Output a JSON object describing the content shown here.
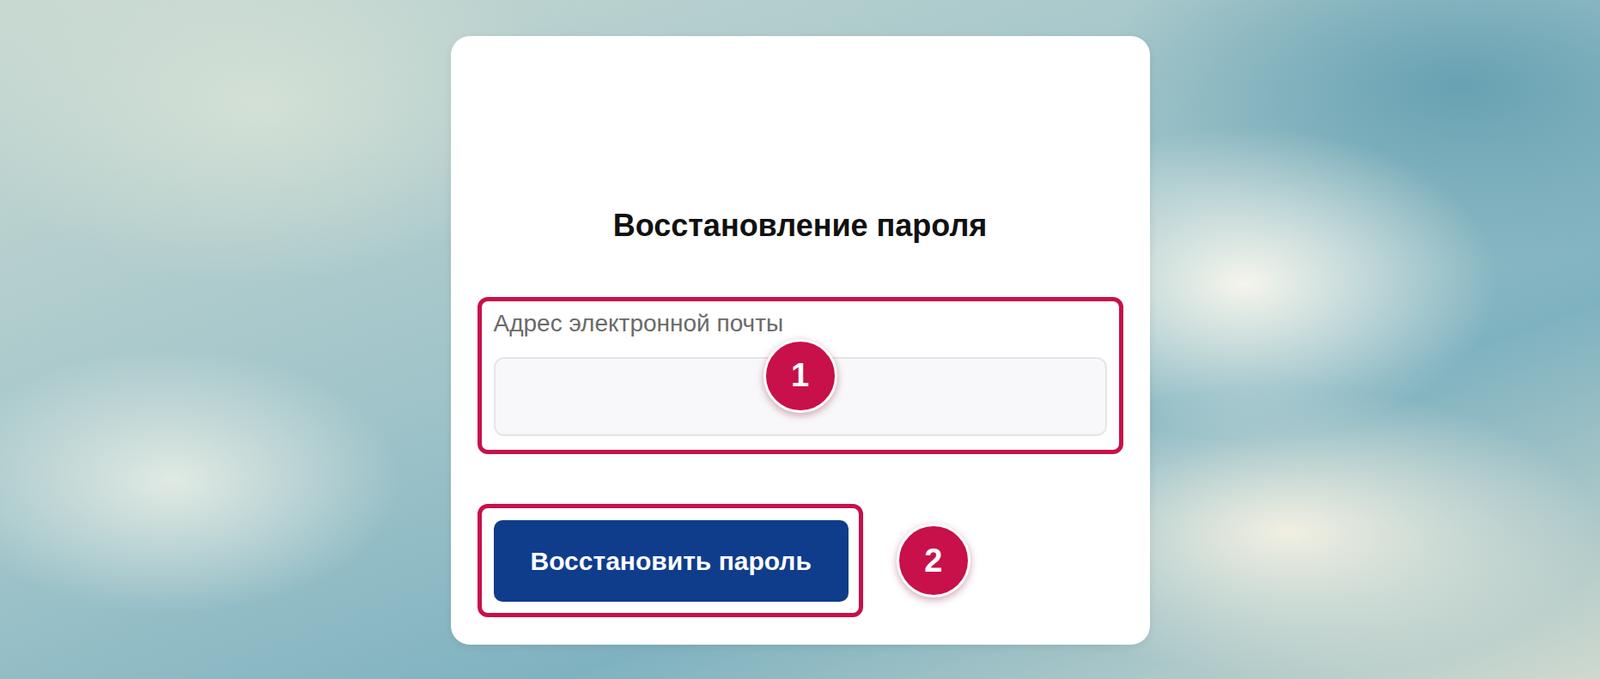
{
  "form": {
    "title": "Восстановление пароля",
    "field": {
      "label": "Адрес электронной почты",
      "value": "",
      "marker": "1"
    },
    "submit": {
      "label": "Восстановить пароль",
      "marker": "2"
    }
  }
}
